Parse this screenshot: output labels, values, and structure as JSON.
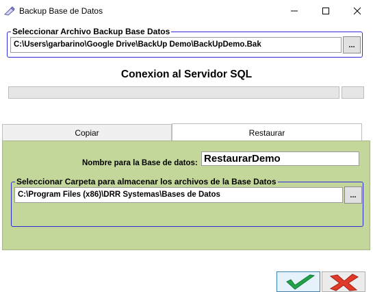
{
  "window": {
    "title": "Backup Base de Datos",
    "icon": "pencil-eraser-icon"
  },
  "backup_file": {
    "legend": "Seleccionar Archivo Backup Base Datos",
    "value": "C:\\Users\\garbarino\\Google Drive\\BackUp Demo\\BackUpDemo.Bak",
    "browse_label": "..."
  },
  "connection": {
    "title": "Conexion al Servidor SQL",
    "progress": 0
  },
  "tabs": [
    {
      "label": "Copiar",
      "active": false
    },
    {
      "label": "Restaurar",
      "active": true
    }
  ],
  "restore": {
    "db_name_label": "Nombre para la Base de datos:",
    "db_name_value": "RestaurarDemo",
    "folder_legend": "Seleccionar Carpeta para almacenar los archivos de la  Base Datos",
    "folder_value": "C:\\Program Files (x86)\\DRR Systemas\\Bases de Datos",
    "browse_label": "..."
  },
  "actions": {
    "ok_icon": "green-checkmark-icon",
    "cancel_icon": "red-x-icon"
  },
  "colors": {
    "panel_green": "#c4d79b",
    "groupbox_border": "#2b2bd8",
    "check_green": "#22a34a",
    "cancel_red": "#e03a2a"
  }
}
